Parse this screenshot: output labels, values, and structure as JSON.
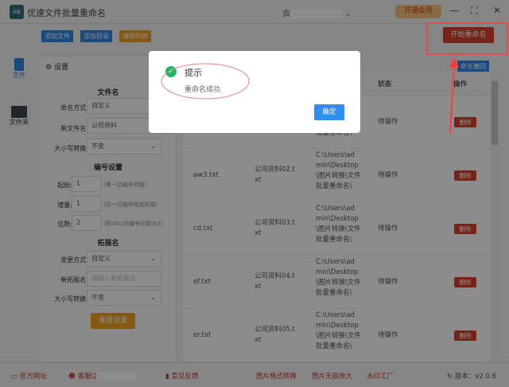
{
  "app": {
    "title": "优速文件批量重命名",
    "user_prefix": "会",
    "vip_label": "开通会员"
  },
  "toolbar": {
    "add_file": "添加文件",
    "add_folder": "添加目录",
    "clear_list": "清除列表",
    "start_rename": "开始重命名",
    "undo_rename": "命名撤回"
  },
  "sidebar": {
    "items": [
      {
        "label": "文件"
      },
      {
        "label": "文件夹"
      }
    ]
  },
  "settings": {
    "title": "设置",
    "filename_section": "文件名",
    "naming_mode_label": "命名方式:",
    "naming_mode": "自定义",
    "new_name_label": "新文件名:",
    "new_name": "公司资料",
    "case_label": "大小写转换:",
    "case_value": "不变",
    "number_section": "编号设置",
    "start_label": "起始:",
    "start": "1",
    "start_hint": "(第一位编号的值)",
    "step_label": "增量:",
    "step": "1",
    "step_hint": "(后一位编号增加的值)",
    "digits_label": "位数:",
    "digits": "2",
    "digits_hint": "(例:001的编号位数为3)",
    "ext_section": "拓展名",
    "ext_mode_label": "变更方式:",
    "ext_mode": "自定义",
    "new_ext_label": "新拓展名:",
    "new_ext_placeholder": "请输入新拓展名",
    "ext_case_label": "大小写转换:",
    "ext_case_value": "不变",
    "reset": "重置设置"
  },
  "table": {
    "headers": {
      "status": "状态",
      "action": "操作"
    },
    "path": "C:\\Users\\admin\\Desktop\\图片转换\\文件批量重命名\\",
    "rows": [
      {
        "name": "",
        "new_name": "",
        "status": "待操作",
        "action": "删除"
      },
      {
        "name": "aw3.txt",
        "new_name": "公司资料02.txt",
        "status": "待操作",
        "action": "删除"
      },
      {
        "name": "cd.txt",
        "new_name": "公司资料03.txt",
        "status": "待操作",
        "action": "删除"
      },
      {
        "name": "ef.txt",
        "new_name": "公司资料04.txt",
        "status": "待操作",
        "action": "删除"
      },
      {
        "name": "er.txt",
        "new_name": "公司资料05.txt",
        "status": "待操作",
        "action": "删除"
      }
    ]
  },
  "footer": {
    "website": "官方网址",
    "support": "客服Q",
    "feedback": "意见反馈",
    "link1": "图片格式转换",
    "link2": "图片无损放大",
    "link3": "水印工厂",
    "version": "版本：v2.0.6"
  },
  "dialog": {
    "title": "提示",
    "message": "重命名成功",
    "ok": "确定"
  }
}
